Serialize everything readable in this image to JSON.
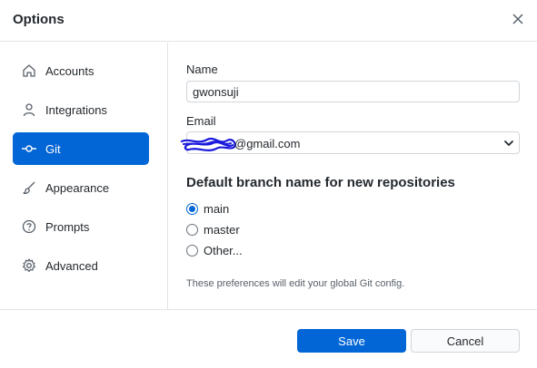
{
  "dialog": {
    "title": "Options"
  },
  "sidebar": {
    "items": [
      {
        "label": "Accounts",
        "icon": "home-icon",
        "active": false
      },
      {
        "label": "Integrations",
        "icon": "person-icon",
        "active": false
      },
      {
        "label": "Git",
        "icon": "git-commit-icon",
        "active": true
      },
      {
        "label": "Appearance",
        "icon": "paintbrush-icon",
        "active": false
      },
      {
        "label": "Prompts",
        "icon": "question-icon",
        "active": false
      },
      {
        "label": "Advanced",
        "icon": "gear-icon",
        "active": false
      }
    ]
  },
  "git": {
    "name_label": "Name",
    "name_value": "gwonsuji",
    "email_label": "Email",
    "email_value": "@gmail.com",
    "branch_heading": "Default branch name for new repositories",
    "branch_options": [
      {
        "label": "main",
        "checked": true
      },
      {
        "label": "master",
        "checked": false
      },
      {
        "label": "Other...",
        "checked": false
      }
    ],
    "note": "These preferences will edit your global Git config."
  },
  "footer": {
    "save_label": "Save",
    "cancel_label": "Cancel"
  },
  "colors": {
    "accent": "#0366d6",
    "redaction": "#1a1adc"
  }
}
